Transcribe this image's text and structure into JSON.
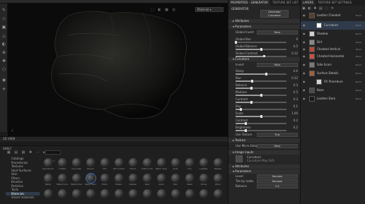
{
  "viewport": {
    "display_mode": "Material"
  },
  "shelf": {
    "title": "SHELF",
    "panel_2d_title": "2D VIEW",
    "categories": [
      "Catalogs",
      "Procedurals",
      "Textures",
      "Hard Surfaces",
      "Skin",
      "Filters",
      "Brushes",
      "Particles",
      "Tools",
      "Materials",
      "Smart materials"
    ],
    "selected_category": 9,
    "search_placeholder": "Search",
    "materials": [
      "Aluminium",
      "Cobble",
      "Concrete",
      "Denim",
      "Dirt",
      "Dirt Cracks",
      "Fabric",
      "Fabric Old",
      "Fabric Rough",
      "Gold",
      "Iron",
      "Leather",
      "Marble",
      "Metal",
      "Metal Scratch",
      "Metal Silver",
      "Metal Worn",
      "Paint",
      "Plastic",
      "Rubber",
      "Rust",
      "Sand",
      "Skin",
      "Steel",
      "Stone",
      "Wood"
    ]
  },
  "properties": {
    "tabs": [
      "PROPERTIES - GENERATOR",
      "TEXTURE SET LIST",
      "SHADER SETTINGS"
    ],
    "header": "GENERATOR",
    "generator_button_line1": "Generator",
    "generator_button_line2": "Curvature",
    "sections": {
      "attributes": "Attributes",
      "parameters": "Parameters",
      "curvature": "Curvature",
      "texture": "Texture",
      "image_inputs": "Image inputs",
      "attributes2": "Attributes",
      "parameters2": "Parameters"
    },
    "global_invert": {
      "label": "Global Invert",
      "value": "False"
    },
    "sliders": [
      {
        "label": "Global Blur",
        "value": "0"
      },
      {
        "label": "Global Balance",
        "value": "0.5"
      },
      {
        "label": "Global Contrast",
        "value": "0.12"
      },
      {
        "label": "Invert",
        "value": "False"
      },
      {
        "label": "Sharp",
        "value": "0.6"
      },
      {
        "label": "Blur",
        "value": "0.32"
      },
      {
        "label": "Balance",
        "value": "0.3"
      },
      {
        "label": "Medium",
        "value": "0.5"
      },
      {
        "label": "Contrast",
        "value": "0.3"
      },
      {
        "label": "Blur",
        "value": "0.1"
      },
      {
        "label": "Scale",
        "value": "1.00"
      },
      {
        "label": "Contrast",
        "value": "0.2"
      },
      {
        "label": "Brightness",
        "value": "0.2"
      }
    ],
    "use_texture": {
      "label": "Use Texture",
      "value": "True"
    },
    "use_micro_details": {
      "label": "Use Micro Details",
      "value": "False"
    },
    "image_input_label": "Curvature",
    "image_input_sub": "Curvature Map SVS",
    "param2": [
      {
        "label": "Level",
        "value": "Random"
      },
      {
        "label": "Tile by index",
        "value": "Random"
      },
      {
        "label": "Balance",
        "value": "0.5"
      }
    ]
  },
  "layers": {
    "tabs": [
      "LAYERS",
      "TEXTURE SET SETTINGS"
    ],
    "items": [
      {
        "name": "Leather Cheated",
        "blend": "Norm"
      },
      {
        "name": "Curvature",
        "blend": "Norm"
      },
      {
        "name": "Shadow",
        "blend": "Norm"
      },
      {
        "name": "Dirt",
        "blend": "Norm"
      },
      {
        "name": "Cheated Vertical",
        "blend": "Norm"
      },
      {
        "name": "Cheated Horizontal",
        "blend": "Norm"
      },
      {
        "name": "Side Scars",
        "blend": "Norm"
      },
      {
        "name": "Surface Details",
        "blend": "Norm"
      },
      {
        "name": "Fill Procedure",
        "blend": "Norm"
      },
      {
        "name": "Base",
        "blend": "Norm"
      },
      {
        "name": "Leather Dark",
        "blend": "Norm"
      }
    ]
  }
}
